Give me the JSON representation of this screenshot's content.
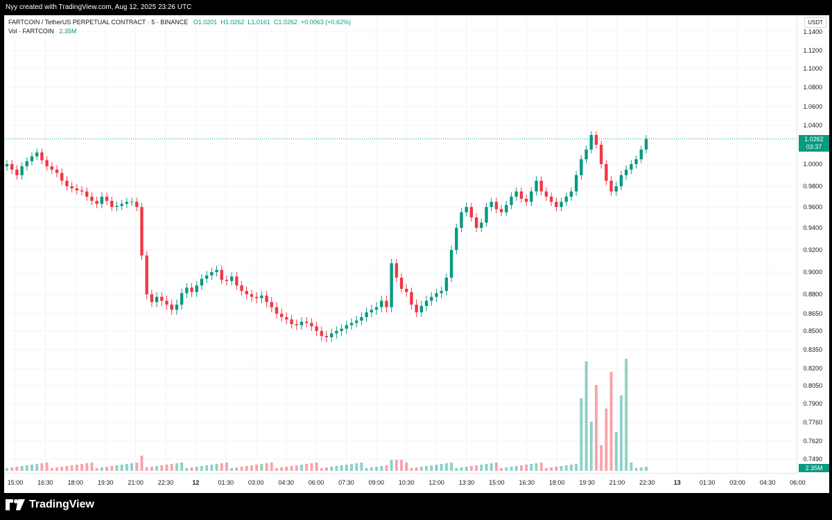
{
  "header": {
    "caption": "Nyy created with TradingView.com, Aug 12, 2025 23:26 UTC"
  },
  "legend": {
    "symbol": "FARTCOIN / TetherUS PERPETUAL CONTRACT · 5 · BINANCE",
    "open": "O1.0201",
    "high": "H1.0262",
    "low": "L1.0161",
    "close": "C1.0262",
    "change": "+0.0063 (+0.62%)",
    "vol_label": "Vol · FARTCOIN",
    "vol_value": "2.35M"
  },
  "price_axis": {
    "unit": "USDT",
    "ticks": [
      "1.1400",
      "1.1200",
      "1.1000",
      "1.0800",
      "1.0600",
      "1.0400",
      "1.0000",
      "0.9800",
      "0.9600",
      "0.9400",
      "0.9200",
      "0.9000",
      "0.8800",
      "0.8650",
      "0.8500",
      "0.8350",
      "0.8200",
      "0.8050",
      "0.7900",
      "0.7760",
      "0.7620",
      "0.7490"
    ],
    "last_price": "1.0262",
    "countdown": "03:37",
    "volume_last": "2.35M"
  },
  "time_axis": {
    "ticks": [
      "15:00",
      "16:30",
      "18:00",
      "19:30",
      "21:00",
      "22:30",
      "12",
      "01:30",
      "03:00",
      "04:30",
      "06:00",
      "07:30",
      "09:00",
      "10:30",
      "12:00",
      "13:30",
      "15:00",
      "16:30",
      "18:00",
      "19:30",
      "21:00",
      "22:30",
      "13",
      "01:30",
      "03:00",
      "04:30",
      "06:00"
    ]
  },
  "colors": {
    "up": "#089981",
    "down": "#f23645",
    "grid": "#f0f3fa",
    "background": "#ffffff"
  },
  "chart_data": {
    "type": "candlestick",
    "series": [
      {
        "name": "FARTCOIN / TetherUS PERPETUAL CONTRACT",
        "values": [
          1.0,
          0.995,
          0.99,
          0.998,
          1.003,
          1.008,
          1.012,
          1.004,
          0.998,
          0.995,
          0.992,
          0.985,
          0.98,
          0.978,
          0.976,
          0.975,
          0.97,
          0.966,
          0.963,
          0.97,
          0.966,
          0.96,
          0.961,
          0.963,
          0.965,
          0.965,
          0.96,
          0.915,
          0.88,
          0.874,
          0.878,
          0.875,
          0.872,
          0.868,
          0.872,
          0.881,
          0.886,
          0.882,
          0.888,
          0.894,
          0.897,
          0.9,
          0.902,
          0.893,
          0.892,
          0.896,
          0.888,
          0.883,
          0.88,
          0.878,
          0.877,
          0.879,
          0.874,
          0.87,
          0.865,
          0.862,
          0.86,
          0.856,
          0.855,
          0.858,
          0.857,
          0.854,
          0.85,
          0.846,
          0.845,
          0.848,
          0.85,
          0.852,
          0.855,
          0.857,
          0.859,
          0.862,
          0.866,
          0.868,
          0.87,
          0.875,
          0.87,
          0.908,
          0.895,
          0.885,
          0.882,
          0.872,
          0.866,
          0.871,
          0.875,
          0.878,
          0.881,
          0.883,
          0.895,
          0.92,
          0.94,
          0.955,
          0.96,
          0.95,
          0.94,
          0.945,
          0.96,
          0.965,
          0.958,
          0.955,
          0.962,
          0.97,
          0.975,
          0.968,
          0.965,
          0.975,
          0.985,
          0.975,
          0.97,
          0.965,
          0.96,
          0.965,
          0.97,
          0.975,
          0.99,
          1.005,
          1.015,
          1.03,
          1.02,
          1.0,
          0.985,
          0.975,
          0.98,
          0.99,
          0.995,
          1.0,
          1.005,
          1.015,
          1.026
        ]
      }
    ],
    "x_range": [
      "15:00",
      "06:00"
    ],
    "ylim": [
      0.745,
      1.145
    ],
    "ylabel": "USDT",
    "grid": true,
    "legend": "top-left"
  }
}
